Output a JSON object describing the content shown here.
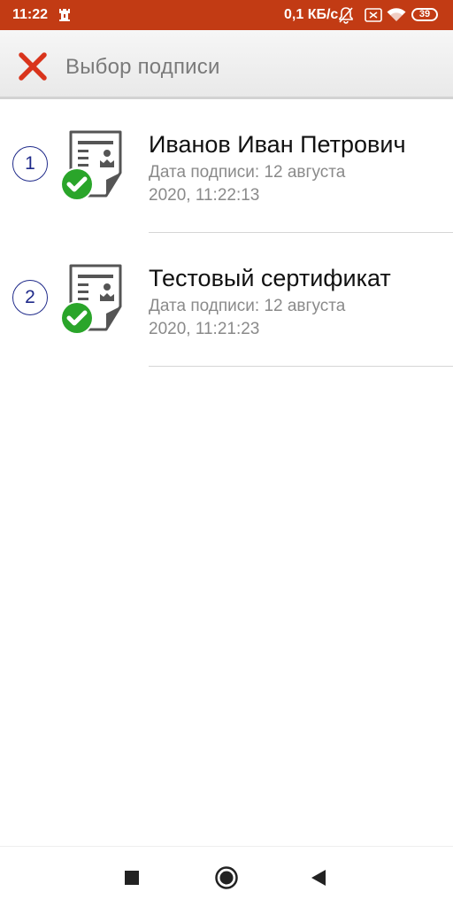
{
  "status_bar": {
    "time": "11:22",
    "network_speed": "0,1 КБ/с",
    "battery_level": "39",
    "icons": [
      "castle-icon",
      "bell-off-icon",
      "sim-off-icon",
      "wifi-icon",
      "battery-icon"
    ]
  },
  "app_bar": {
    "title": "Выбор подписи",
    "close_icon": "close-icon",
    "accent_color": "#d9341c"
  },
  "signatures": [
    {
      "number": "1",
      "name": "Иванов Иван Петрович",
      "date_line1": "Дата подписи: 12 августа",
      "date_line2": "2020, 11:22:13",
      "icon": "certificate-valid-icon"
    },
    {
      "number": "2",
      "name": "Тестовый сертификат",
      "date_line1": "Дата подписи: 12 августа",
      "date_line2": "2020, 11:21:23",
      "icon": "certificate-valid-icon"
    }
  ],
  "nav_bar": {
    "icons": [
      "recent-apps-icon",
      "home-icon",
      "back-icon"
    ]
  },
  "colors": {
    "status_bar": "#c23b14",
    "badge_outline": "#1f2a8a",
    "check_green": "#2aa52a"
  }
}
